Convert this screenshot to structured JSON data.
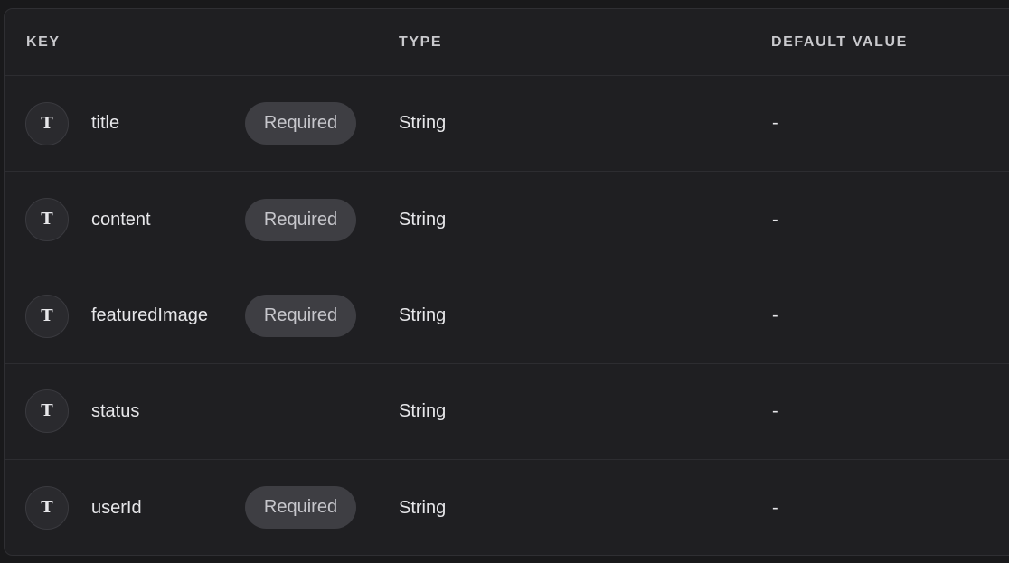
{
  "table": {
    "headers": {
      "key": "KEY",
      "type": "TYPE",
      "default_value": "DEFAULT VALUE"
    },
    "rows": [
      {
        "icon": "text-type-icon",
        "icon_glyph": "T",
        "key": "title",
        "required_label": "Required",
        "type": "String",
        "default": "-"
      },
      {
        "icon": "text-type-icon",
        "icon_glyph": "T",
        "key": "content",
        "required_label": "Required",
        "type": "String",
        "default": "-"
      },
      {
        "icon": "text-type-icon",
        "icon_glyph": "T",
        "key": "featuredImage",
        "required_label": "Required",
        "type": "String",
        "default": "-"
      },
      {
        "icon": "text-type-icon",
        "icon_glyph": "T",
        "key": "status",
        "required_label": "",
        "type": "String",
        "default": "-"
      },
      {
        "icon": "text-type-icon",
        "icon_glyph": "T",
        "key": "userId",
        "required_label": "Required",
        "type": "String",
        "default": "-"
      }
    ]
  },
  "colors": {
    "background": "#19191b",
    "panel": "#1f1f22",
    "badge": "#3e3e43",
    "text": "#e7e7ea",
    "header_text": "#c9c9cd"
  }
}
